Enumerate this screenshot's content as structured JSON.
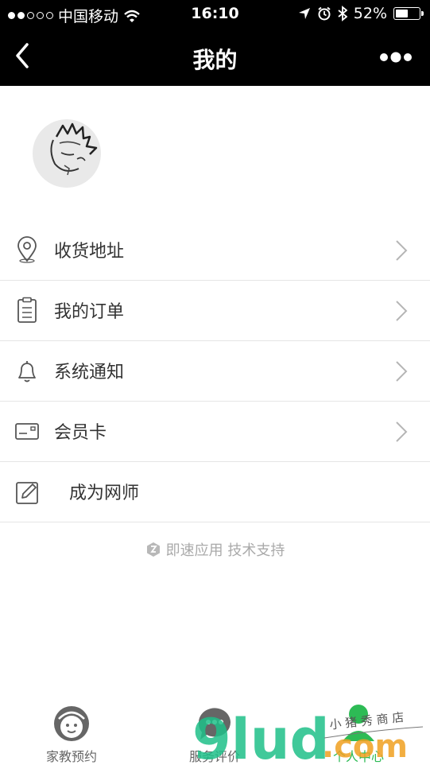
{
  "status_bar": {
    "carrier": "中国移动",
    "time": "16:10",
    "battery": "52%",
    "battery_level": 0.52
  },
  "nav": {
    "title": "我的",
    "back_icon": "chevron-left-icon",
    "more_icon": "more-dots-icon"
  },
  "menu": [
    {
      "label": "收货地址",
      "icon": "location-pin-icon"
    },
    {
      "label": "我的订单",
      "icon": "clipboard-icon"
    },
    {
      "label": "系统通知",
      "icon": "bell-icon"
    },
    {
      "label": "会员卡",
      "icon": "card-icon"
    },
    {
      "label": "成为网师",
      "icon": "edit-icon"
    }
  ],
  "support_text": "即速应用 技术支持",
  "tabs": [
    {
      "label": "家教预约",
      "icon": "face-icon",
      "active": false
    },
    {
      "label": "服务评价",
      "icon": "chat-icon",
      "active": false
    },
    {
      "label": "个人中心",
      "icon": "person-icon",
      "active": true
    }
  ],
  "watermark": {
    "text": "9lud",
    "suffix": ".com",
    "script": "小 猪 秀 商 店"
  },
  "colors": {
    "bar_bg": "#000000",
    "active_tab": "#2dbb55",
    "chevron": "#b5b5b5"
  }
}
